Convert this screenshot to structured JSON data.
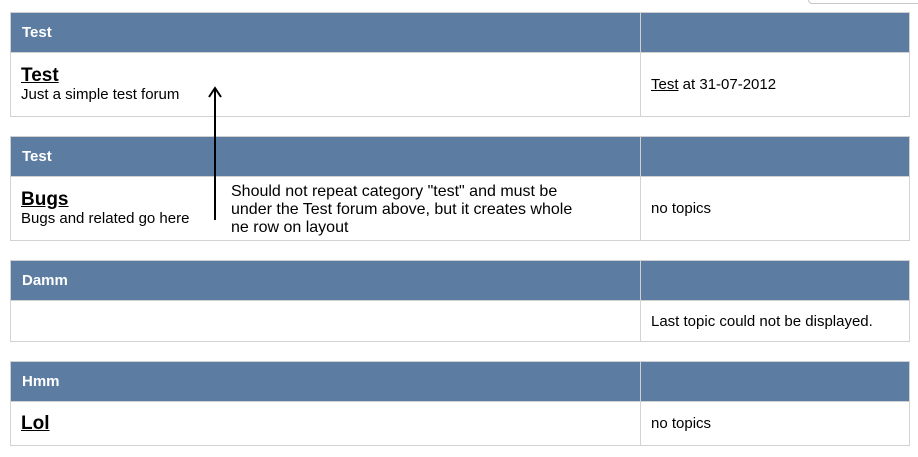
{
  "categories": [
    {
      "name": "Test",
      "forum": {
        "title": "Test",
        "description": "Just a simple test forum"
      },
      "last": {
        "link": "Test",
        "text": " at 31-07-2012"
      }
    },
    {
      "name": "Test",
      "forum": {
        "title": "Bugs",
        "description": "Bugs and related go here"
      },
      "last": {
        "text": "no topics"
      }
    },
    {
      "name": "Damm",
      "last": {
        "text": "Last topic could not be displayed."
      }
    },
    {
      "name": "Hmm",
      "forum": {
        "title": "Lol"
      },
      "last": {
        "text": "no topics"
      }
    }
  ],
  "annotation": {
    "text": "Should not repeat category \"test\" and must be\nunder the Test forum above, but it creates whole\nne row on layout",
    "arrow_icon": "up-arrow-icon"
  },
  "colors": {
    "header_bg": "#5d7ca2",
    "header_text": "#ffffff",
    "border": "#d3d3d3"
  }
}
